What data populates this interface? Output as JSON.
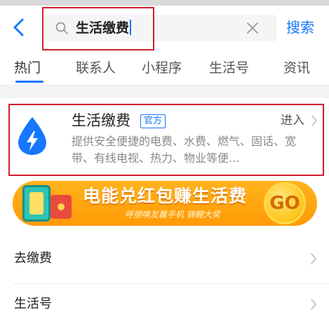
{
  "search": {
    "query": "生活缴费",
    "action_label": "搜索"
  },
  "tabs": [
    {
      "label": "热门"
    },
    {
      "label": "联系人"
    },
    {
      "label": "小程序"
    },
    {
      "label": "生活号"
    },
    {
      "label": "资讯"
    }
  ],
  "result": {
    "title": "生活缴费",
    "badge": "官方",
    "enter_label": "进入",
    "description": "提供安全便捷的电费、水费、燃气、固话、宽带、有线电视、热力、物业等便..."
  },
  "banner": {
    "title": "电能兑红包赚生活费",
    "subtitle": "呼朋唤友赢手机 锦鲤大奖",
    "go_label": "GO"
  },
  "list": [
    {
      "label": "去缴费"
    },
    {
      "label": "生活号"
    }
  ],
  "colors": {
    "accent": "#1677ff",
    "highlight_box": "#cf1f2e",
    "banner_orange": "#ffa50f"
  }
}
